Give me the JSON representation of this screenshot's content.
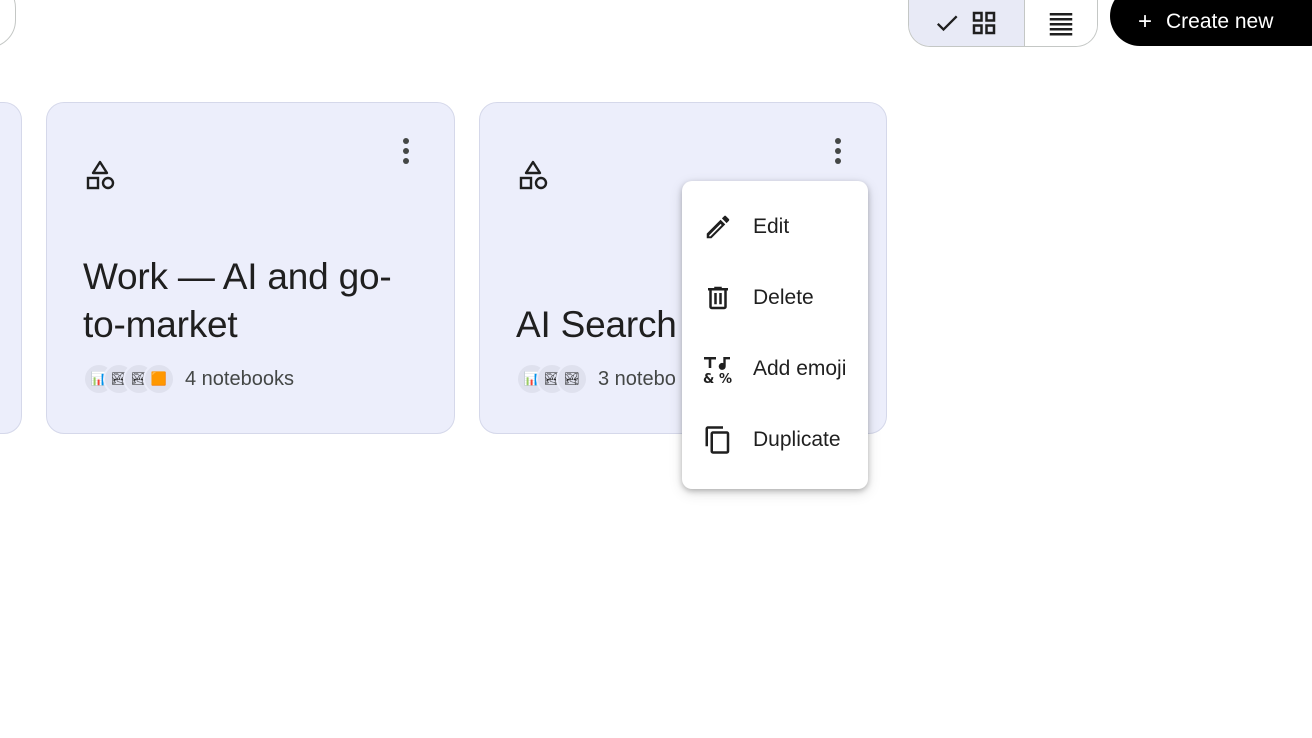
{
  "toolbar": {
    "create_new_label": "Create new",
    "create_new_plus": "+",
    "view_grid_selected": true
  },
  "cards": [
    {
      "title": "Work — AI and go-to-market",
      "notebook_count": "4 notebooks",
      "avatars": [
        "📊",
        "🏞",
        "🏞",
        "🟧"
      ]
    },
    {
      "title": "AI Search S",
      "notebook_count": "3 notebo",
      "avatars": [
        "📊",
        "🏞",
        "🏞"
      ]
    }
  ],
  "context_menu": {
    "items": [
      {
        "label": "Edit",
        "icon": "pencil-icon"
      },
      {
        "label": "Delete",
        "icon": "trash-icon"
      },
      {
        "label": "Add emoji",
        "icon": "text-format-icon"
      },
      {
        "label": "Duplicate",
        "icon": "copy-icon"
      }
    ]
  },
  "colors": {
    "card_bg": "#eceefb",
    "selected_toggle_bg": "#e8eaf6",
    "primary_button_bg": "#000000"
  }
}
